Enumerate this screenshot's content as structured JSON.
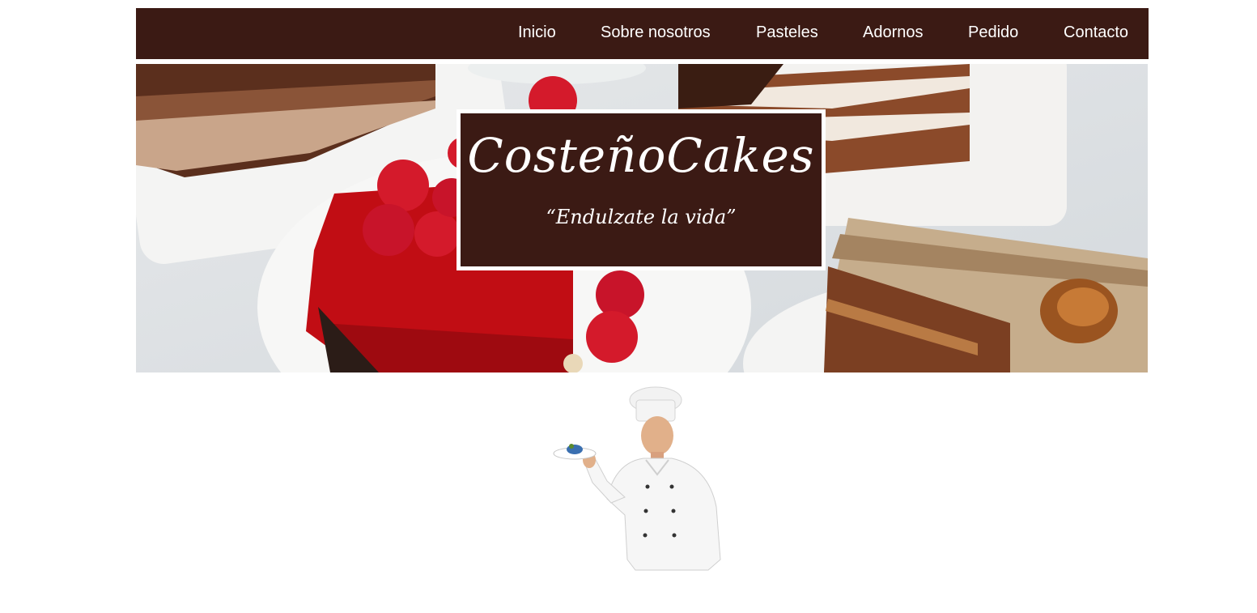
{
  "nav": {
    "items": [
      {
        "label": "Inicio"
      },
      {
        "label": "Sobre nosotros"
      },
      {
        "label": "Pasteles"
      },
      {
        "label": "Adornos"
      },
      {
        "label": "Pedido"
      },
      {
        "label": "Contacto"
      }
    ]
  },
  "hero": {
    "brand": "CosteñoCakes",
    "tagline": "“Endulzate la vida”"
  },
  "colors": {
    "primary": "#3b1a14",
    "text_on_primary": "#ffffff"
  }
}
